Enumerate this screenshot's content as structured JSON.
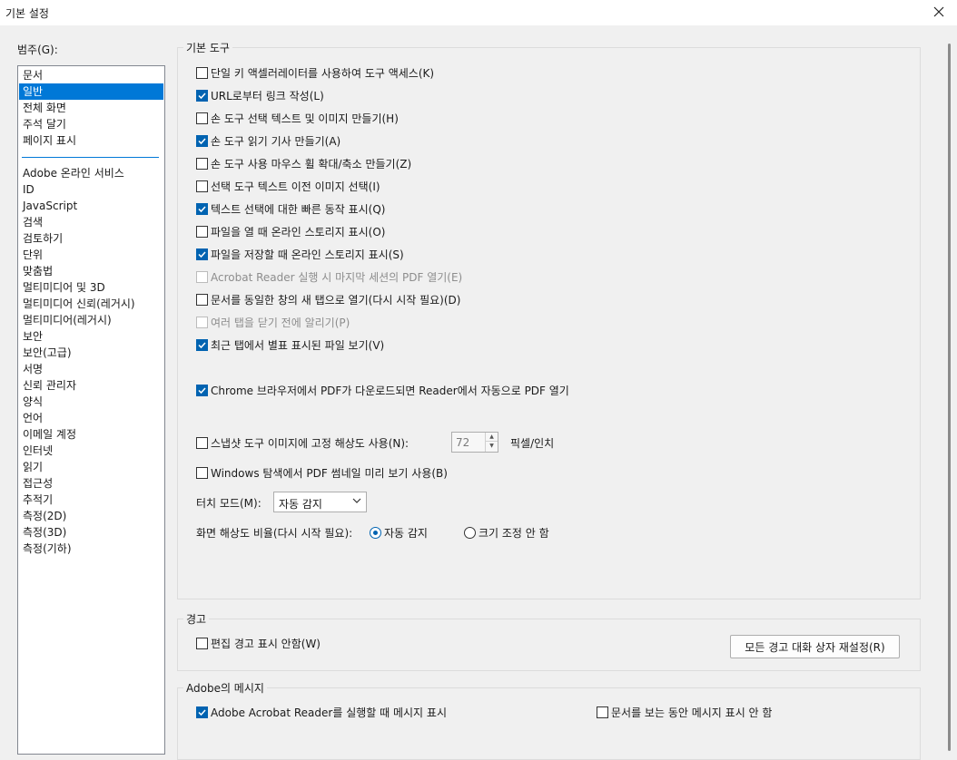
{
  "window": {
    "title": "기본 설정"
  },
  "category": {
    "label": "범주(G):",
    "top_items": [
      "문서",
      "일반",
      "전체 화면",
      "주석 달기",
      "페이지 표시"
    ],
    "bottom_items": [
      "Adobe 온라인 서비스",
      "ID",
      "JavaScript",
      "검색",
      "검토하기",
      "단위",
      "맞춤법",
      "멀티미디어 및 3D",
      "멀티미디어 신뢰(레거시)",
      "멀티미디어(레거시)",
      "보안",
      "보안(고급)",
      "서명",
      "신뢰 관리자",
      "양식",
      "언어",
      "이메일 계정",
      "인터넷",
      "읽기",
      "접근성",
      "추적기",
      "측정(2D)",
      "측정(3D)",
      "측정(기하)"
    ],
    "selected": "일반"
  },
  "basic_tools": {
    "title": "기본 도구",
    "options": [
      {
        "label": "단일 키 액셀러레이터를 사용하여 도구 액세스(K)",
        "checked": false,
        "disabled": false
      },
      {
        "label": "URL로부터 링크 작성(L)",
        "checked": true,
        "disabled": false
      },
      {
        "label": "손 도구 선택 텍스트 및 이미지 만들기(H)",
        "checked": false,
        "disabled": false
      },
      {
        "label": "손 도구 읽기 기사 만들기(A)",
        "checked": true,
        "disabled": false
      },
      {
        "label": "손 도구 사용 마우스 휠 확대/축소 만들기(Z)",
        "checked": false,
        "disabled": false
      },
      {
        "label": "선택 도구 텍스트 이전 이미지 선택(I)",
        "checked": false,
        "disabled": false
      },
      {
        "label": "텍스트 선택에 대한 빠른 동작 표시(Q)",
        "checked": true,
        "disabled": false
      },
      {
        "label": "파일을 열 때 온라인 스토리지 표시(O)",
        "checked": false,
        "disabled": false
      },
      {
        "label": "파일을 저장할 때 온라인 스토리지 표시(S)",
        "checked": true,
        "disabled": false
      },
      {
        "label": "Acrobat Reader 실행 시 마지막 세션의 PDF 열기(E)",
        "checked": false,
        "disabled": true
      },
      {
        "label": "문서를 동일한 창의 새 탭으로 열기(다시 시작 필요)(D)",
        "checked": false,
        "disabled": false
      },
      {
        "label": "여러 탭을 닫기 전에 알리기(P)",
        "checked": false,
        "disabled": true
      },
      {
        "label": "최근 탭에서 별표 표시된 파일 보기(V)",
        "checked": true,
        "disabled": false
      }
    ],
    "chrome_option": {
      "label": "Chrome 브라우저에서 PDF가 다운로드되면 Reader에서 자동으로 PDF 열기",
      "checked": true
    },
    "snapshot": {
      "label": "스냅샷 도구 이미지에 고정 해상도 사용(N):",
      "checked": false,
      "value": "72",
      "unit": "픽셀/인치"
    },
    "thumbnail": {
      "label": "Windows 탐색에서 PDF 썸네일 미리 보기 사용(B)",
      "checked": false
    },
    "touch_mode": {
      "label": "터치 모드(M):",
      "value": "자동 감지"
    },
    "scaling": {
      "label": "화면 해상도 비율(다시 시작 필요):",
      "options": [
        {
          "label": "자동 감지",
          "checked": true
        },
        {
          "label": "크기 조정 안 함",
          "checked": false
        }
      ]
    }
  },
  "warnings": {
    "title": "경고",
    "option": {
      "label": "편집 경고 표시 안함(W)",
      "checked": false
    },
    "reset_button": "모든 경고 대화 상자 재설정(R)"
  },
  "messages": {
    "title": "Adobe의 메시지",
    "options": [
      {
        "label": "Adobe Acrobat Reader를 실행할 때 메시지 표시",
        "checked": true
      },
      {
        "label": "문서를 보는 동안 메시지 표시 안 함",
        "checked": false
      }
    ]
  },
  "colors": {
    "accent": "#0078d7",
    "check": "#0063b1"
  }
}
